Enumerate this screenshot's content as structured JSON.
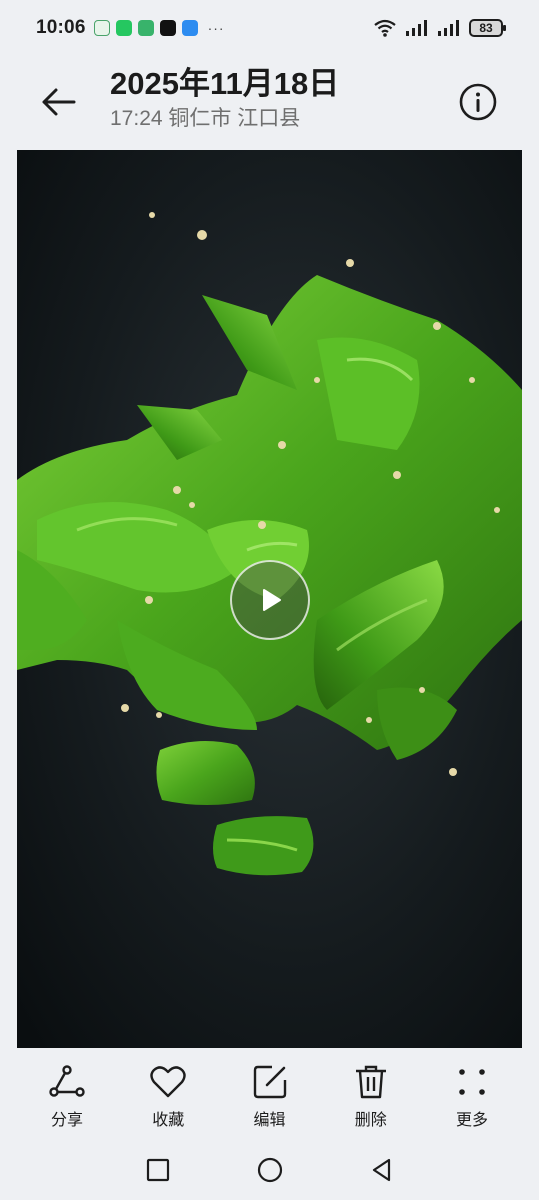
{
  "status_bar": {
    "time": "10:06",
    "battery": "83",
    "notification_icons": [
      "gallery-icon",
      "wechat-icon",
      "game-icon",
      "tiktok-icon",
      "message-icon"
    ],
    "more": "···"
  },
  "header": {
    "date_title": "2025年11月18日",
    "subtitle": "17:24 铜仁市 江口县"
  },
  "toolbar": {
    "share": "分享",
    "favorite": "收藏",
    "edit": "编辑",
    "delete": "删除",
    "more": "更多"
  },
  "colors": {
    "background": "#eef0f3",
    "media_bg": "#0f1416",
    "pepper_green": "#4caf22"
  }
}
